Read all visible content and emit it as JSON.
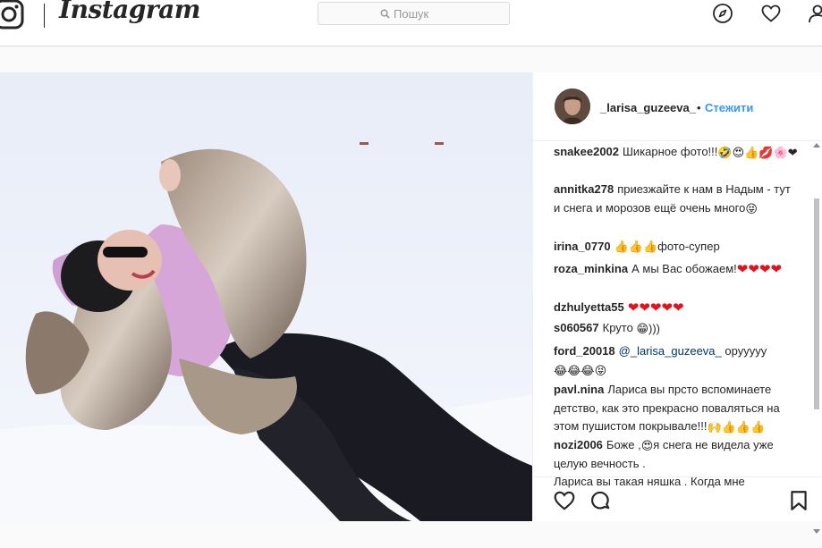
{
  "nav": {
    "logo_text": "Instagram",
    "search_placeholder": "Пошук",
    "icons": [
      "instagram-glyph-icon",
      "compass-icon",
      "heart-icon",
      "profile-icon"
    ]
  },
  "post": {
    "username": "_larisa_guzeeva_",
    "separator": "•",
    "follow_label": "Стежити",
    "comments": [
      {
        "user": "snakee2002",
        "text": "Шикарное фото!!!",
        "emoji": "🤣😍👍💋🌸❤"
      },
      {
        "user": "annitka278",
        "text": "приезжайте к нам в Надым - тут и снега и морозов ещё очень много",
        "emoji": "😝"
      },
      {
        "user": "irina_0770",
        "text": "👍👍👍фото-супер",
        "emoji": ""
      },
      {
        "user": "roza_minkina",
        "text": "А мы Вас обожаем!",
        "emoji": "❤❤❤❤"
      },
      {
        "user": "dzhulyetta55",
        "text": "",
        "emoji": "❤❤❤❤❤"
      },
      {
        "user": "s060567",
        "text": "Круто",
        "emoji": "😁)))"
      },
      {
        "user": "ford_20018",
        "mention": "@_larisa_guzeeva_",
        "text": " орууууу",
        "emoji": "😂😂😂😝"
      },
      {
        "user": "pavl.nina",
        "text": "Лариса вы прсто вспоминаете детство, как это прекрасно поваляться на этом пушистом покрывале!!!",
        "emoji": "🙌👍👍👍"
      },
      {
        "user": "nozi2006",
        "text_a": "Боже ,",
        "text_b": "я снега не видела уже целую вечность .",
        "text_c": "Лариса вы такая няшка . Когда мне",
        "emoji": "😍"
      }
    ]
  },
  "colors": {
    "accent": "#3897f0",
    "text": "#262626",
    "border": "#dbdbdb",
    "heart": "#e0141f"
  }
}
